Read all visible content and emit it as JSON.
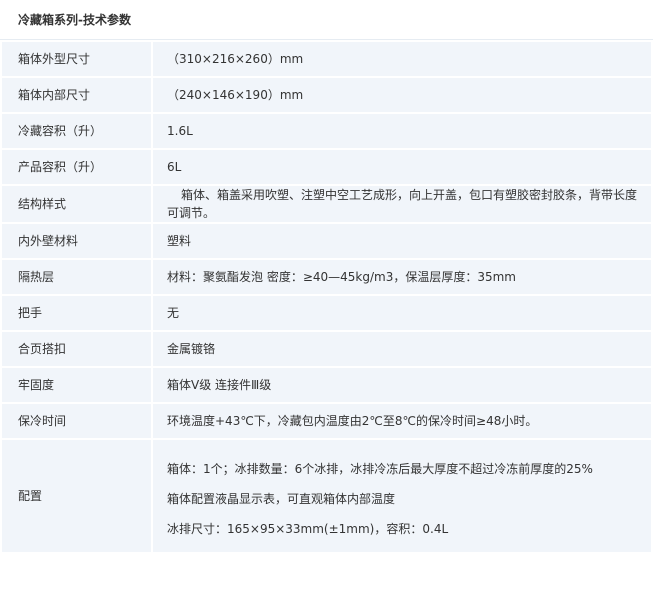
{
  "title": "冷藏箱系列-技术参数",
  "rows": [
    {
      "label": "箱体外型尺寸",
      "value": "（310×216×260）mm"
    },
    {
      "label": "箱体内部尺寸",
      "value": "（240×146×190）mm"
    },
    {
      "label": "冷藏容积（升）",
      "value": "1.6L"
    },
    {
      "label": "产品容积（升）",
      "value": "6L"
    },
    {
      "label": "结构样式",
      "value": "箱体、箱盖采用吹塑、注塑中空工艺成形，向上开盖，包口有塑胶密封胶条，背带长度可调节。"
    },
    {
      "label": "内外壁材料",
      "value": "塑料"
    },
    {
      "label": "隔热层",
      "value": "材料：聚氨酯发泡 密度：≥40—45kg/m3，保温层厚度：35mm"
    },
    {
      "label": "把手",
      "value": "无"
    },
    {
      "label": "合页搭扣",
      "value": "金属镀铬"
    },
    {
      "label": "牢固度",
      "value": "箱体V级 连接件Ⅲ级"
    },
    {
      "label": "保冷时间",
      "value": "环境温度+43℃下，冷藏包内温度由2℃至8℃的保冷时间≥48小时。"
    }
  ],
  "config": {
    "label": "配置",
    "lines": [
      "箱体：1个；冰排数量：6个冰排，冰排冷冻后最大厚度不超过冷冻前厚度的25%",
      "箱体配置液晶显示表，可直观箱体内部温度",
      "冰排尺寸：165×95×33mm(±1mm)，容积：0.4L"
    ]
  }
}
